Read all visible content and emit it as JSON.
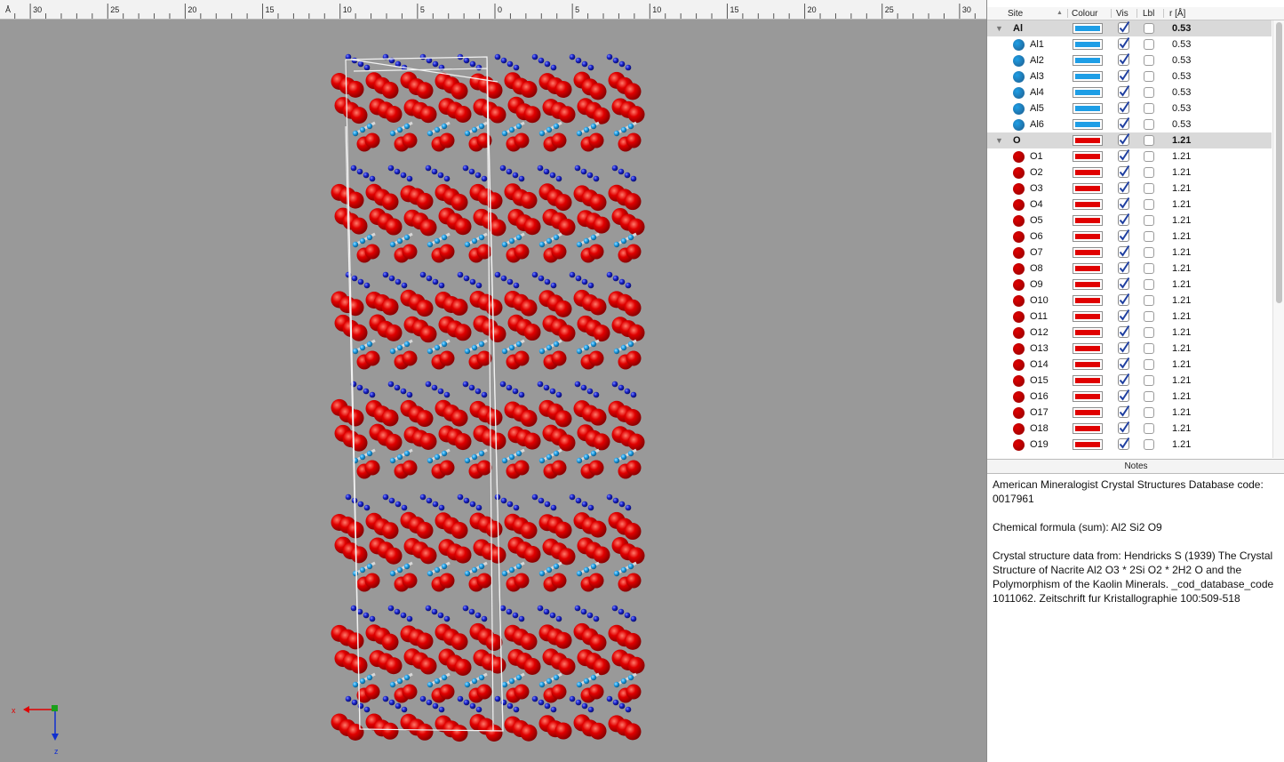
{
  "ruler": {
    "unit": "Å",
    "ticks": [
      {
        "label": "30",
        "v": 30
      },
      {
        "label": "25",
        "v": 25
      },
      {
        "label": "20",
        "v": 20
      },
      {
        "label": "15",
        "v": 15
      },
      {
        "label": "10",
        "v": 10
      },
      {
        "label": "5",
        "v": 5
      },
      {
        "label": "0",
        "v": 0
      },
      {
        "label": "5",
        "v": -5
      },
      {
        "label": "10",
        "v": -10
      },
      {
        "label": "15",
        "v": -15
      },
      {
        "label": "20",
        "v": -20
      },
      {
        "label": "25",
        "v": -25
      },
      {
        "label": "30",
        "v": -30
      }
    ]
  },
  "axes": {
    "x": "x",
    "z": "z"
  },
  "table": {
    "columns": {
      "site": "Site",
      "colour": "Colour",
      "vis": "Vis",
      "lbl": "Lbl",
      "radius": "r [Å]"
    },
    "rows": [
      {
        "group": true,
        "name": "Al",
        "radius": "0.53",
        "vis": true,
        "lbl": false
      },
      {
        "group": false,
        "name": "Al1",
        "radius": "0.53",
        "vis": true,
        "lbl": false
      },
      {
        "group": false,
        "name": "Al2",
        "radius": "0.53",
        "vis": true,
        "lbl": false
      },
      {
        "group": false,
        "name": "Al3",
        "radius": "0.53",
        "vis": true,
        "lbl": false
      },
      {
        "group": false,
        "name": "Al4",
        "radius": "0.53",
        "vis": true,
        "lbl": false
      },
      {
        "group": false,
        "name": "Al5",
        "radius": "0.53",
        "vis": true,
        "lbl": false
      },
      {
        "group": false,
        "name": "Al6",
        "radius": "0.53",
        "vis": true,
        "lbl": false
      },
      {
        "group": true,
        "name": "O",
        "radius": "1.21",
        "vis": true,
        "lbl": false
      },
      {
        "group": false,
        "name": "O1",
        "radius": "1.21",
        "vis": true,
        "lbl": false
      },
      {
        "group": false,
        "name": "O2",
        "radius": "1.21",
        "vis": true,
        "lbl": false
      },
      {
        "group": false,
        "name": "O3",
        "radius": "1.21",
        "vis": true,
        "lbl": false
      },
      {
        "group": false,
        "name": "O4",
        "radius": "1.21",
        "vis": true,
        "lbl": false
      },
      {
        "group": false,
        "name": "O5",
        "radius": "1.21",
        "vis": true,
        "lbl": false
      },
      {
        "group": false,
        "name": "O6",
        "radius": "1.21",
        "vis": true,
        "lbl": false
      },
      {
        "group": false,
        "name": "O7",
        "radius": "1.21",
        "vis": true,
        "lbl": false
      },
      {
        "group": false,
        "name": "O8",
        "radius": "1.21",
        "vis": true,
        "lbl": false
      },
      {
        "group": false,
        "name": "O9",
        "radius": "1.21",
        "vis": true,
        "lbl": false
      },
      {
        "group": false,
        "name": "O10",
        "radius": "1.21",
        "vis": true,
        "lbl": false
      },
      {
        "group": false,
        "name": "O11",
        "radius": "1.21",
        "vis": true,
        "lbl": false
      },
      {
        "group": false,
        "name": "O12",
        "radius": "1.21",
        "vis": true,
        "lbl": false
      },
      {
        "group": false,
        "name": "O13",
        "radius": "1.21",
        "vis": true,
        "lbl": false
      },
      {
        "group": false,
        "name": "O14",
        "radius": "1.21",
        "vis": true,
        "lbl": false
      },
      {
        "group": false,
        "name": "O15",
        "radius": "1.21",
        "vis": true,
        "lbl": false
      },
      {
        "group": false,
        "name": "O16",
        "radius": "1.21",
        "vis": true,
        "lbl": false
      },
      {
        "group": false,
        "name": "O17",
        "radius": "1.21",
        "vis": true,
        "lbl": false
      },
      {
        "group": false,
        "name": "O18",
        "radius": "1.21",
        "vis": true,
        "lbl": false
      },
      {
        "group": false,
        "name": "O19",
        "radius": "1.21",
        "vis": true,
        "lbl": false
      }
    ]
  },
  "colors": {
    "al": "#1e9ee6",
    "al_dot": "#1f6fa6",
    "o": "#e00000",
    "o_dot": "#a60000",
    "viewport_bg": "#999999",
    "check": "#1f3fa0"
  },
  "notes": {
    "title": "Notes",
    "p1": "American Mineralogist Crystal Structures Database code: 0017961",
    "p2": "Chemical formula (sum): Al2 Si2 O9",
    "p3": "Crystal structure data from: Hendricks S (1939)  The Crystal Structure of Nacrite Al2 O3 * 2Si O2 * 2H2 O and the Polymorphism of the Kaolin Minerals. _cod_database_code 1011062. Zeitschrift fur Kristallographie 100:509-518"
  }
}
